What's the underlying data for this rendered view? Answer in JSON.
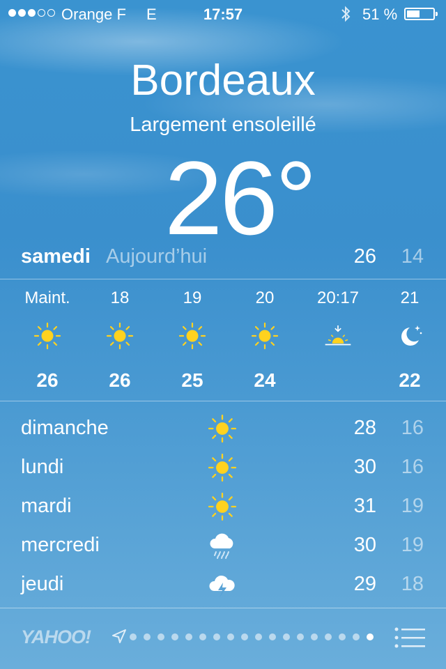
{
  "status_bar": {
    "carrier": "Orange F",
    "network": "E",
    "time": "17:57",
    "battery_percent": "51 %",
    "battery_level": 0.51,
    "signal_bars_filled": 3,
    "signal_bars_total": 5
  },
  "weather": {
    "city": "Bordeaux",
    "condition": "Largement ensoleillé",
    "temperature": "26°"
  },
  "today": {
    "day": "samedi",
    "label": "Aujourd’hui",
    "high": "26",
    "low": "14"
  },
  "hourly": [
    {
      "time": "Maint.",
      "icon": "sun-icon",
      "temp": "26"
    },
    {
      "time": "18",
      "icon": "sun-icon",
      "temp": "26"
    },
    {
      "time": "19",
      "icon": "sun-icon",
      "temp": "25"
    },
    {
      "time": "20",
      "icon": "sun-icon",
      "temp": "24"
    },
    {
      "time": "20:17",
      "icon": "sunset-icon",
      "temp": ""
    },
    {
      "time": "21",
      "icon": "moon-icon",
      "temp": "22"
    }
  ],
  "daily": [
    {
      "day": "dimanche",
      "icon": "sun-icon",
      "high": "28",
      "low": "16"
    },
    {
      "day": "lundi",
      "icon": "sun-icon",
      "high": "30",
      "low": "16"
    },
    {
      "day": "mardi",
      "icon": "sun-icon",
      "high": "31",
      "low": "19"
    },
    {
      "day": "mercredi",
      "icon": "rain-cloud-icon",
      "high": "30",
      "low": "19"
    },
    {
      "day": "jeudi",
      "icon": "thunderstorm-icon",
      "high": "29",
      "low": "18"
    }
  ],
  "footer": {
    "brand": "YAHOO!",
    "page_count": 18,
    "active_page": 18
  },
  "colors": {
    "sun": "#ffd21f",
    "sky": "#3a93d0"
  }
}
